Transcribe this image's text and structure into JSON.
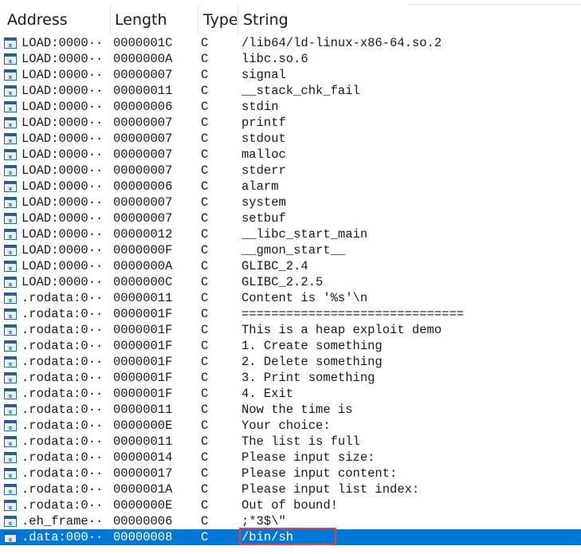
{
  "columns": {
    "address": "Address",
    "length": "Length",
    "type": "Type",
    "string": "String"
  },
  "rows": [
    {
      "address": "LOAD:0000···",
      "length": "0000001C",
      "type": "C",
      "string": "/lib64/ld-linux-x86-64.so.2"
    },
    {
      "address": "LOAD:0000···",
      "length": "0000000A",
      "type": "C",
      "string": "libc.so.6"
    },
    {
      "address": "LOAD:0000···",
      "length": "00000007",
      "type": "C",
      "string": "signal"
    },
    {
      "address": "LOAD:0000···",
      "length": "00000011",
      "type": "C",
      "string": "__stack_chk_fail"
    },
    {
      "address": "LOAD:0000···",
      "length": "00000006",
      "type": "C",
      "string": "stdin"
    },
    {
      "address": "LOAD:0000···",
      "length": "00000007",
      "type": "C",
      "string": "printf"
    },
    {
      "address": "LOAD:0000···",
      "length": "00000007",
      "type": "C",
      "string": "stdout"
    },
    {
      "address": "LOAD:0000···",
      "length": "00000007",
      "type": "C",
      "string": "malloc"
    },
    {
      "address": "LOAD:0000···",
      "length": "00000007",
      "type": "C",
      "string": "stderr"
    },
    {
      "address": "LOAD:0000···",
      "length": "00000006",
      "type": "C",
      "string": "alarm"
    },
    {
      "address": "LOAD:0000···",
      "length": "00000007",
      "type": "C",
      "string": "system"
    },
    {
      "address": "LOAD:0000···",
      "length": "00000007",
      "type": "C",
      "string": "setbuf"
    },
    {
      "address": "LOAD:0000···",
      "length": "00000012",
      "type": "C",
      "string": "__libc_start_main"
    },
    {
      "address": "LOAD:0000···",
      "length": "0000000F",
      "type": "C",
      "string": "__gmon_start__"
    },
    {
      "address": "LOAD:0000···",
      "length": "0000000A",
      "type": "C",
      "string": "GLIBC_2.4"
    },
    {
      "address": "LOAD:0000···",
      "length": "0000000C",
      "type": "C",
      "string": "GLIBC_2.2.5"
    },
    {
      "address": ".rodata:0···",
      "length": "00000011",
      "type": "C",
      "string": "Content is '%s'\\n"
    },
    {
      "address": ".rodata:0···",
      "length": "0000001F",
      "type": "C",
      "string": "=============================="
    },
    {
      "address": ".rodata:0···",
      "length": "0000001F",
      "type": "C",
      "string": " This is a heap exploit demo"
    },
    {
      "address": ".rodata:0···",
      "length": "0000001F",
      "type": "C",
      "string": "1. Create something"
    },
    {
      "address": ".rodata:0···",
      "length": "0000001F",
      "type": "C",
      "string": "2. Delete something"
    },
    {
      "address": ".rodata:0···",
      "length": "0000001F",
      "type": "C",
      "string": "3. Print something"
    },
    {
      "address": ".rodata:0···",
      "length": "0000001F",
      "type": "C",
      "string": "4. Exit"
    },
    {
      "address": ".rodata:0···",
      "length": "00000011",
      "type": "C",
      "string": "Now the time is"
    },
    {
      "address": ".rodata:0···",
      "length": "0000000E",
      "type": "C",
      "string": "Your choice:"
    },
    {
      "address": ".rodata:0···",
      "length": "00000011",
      "type": "C",
      "string": "The list is full"
    },
    {
      "address": ".rodata:0···",
      "length": "00000014",
      "type": "C",
      "string": "Please input size:"
    },
    {
      "address": ".rodata:0···",
      "length": "00000017",
      "type": "C",
      "string": "Please input content:"
    },
    {
      "address": ".rodata:0···",
      "length": "0000001A",
      "type": "C",
      "string": "Please input list index:"
    },
    {
      "address": ".rodata:0···",
      "length": "0000000E",
      "type": "C",
      "string": "Out of bound!"
    },
    {
      "address": ".eh_frame···",
      "length": "00000006",
      "type": "C",
      "string": ";*3$\\\""
    },
    {
      "address": ".data:000···",
      "length": "00000008",
      "type": "C",
      "string": "/bin/sh",
      "selected": true,
      "highlighted": true
    }
  ],
  "icons": {
    "row_icon": "string-entry-icon"
  },
  "colors": {
    "selection": "#0078d7",
    "highlight_box": "#e0414a",
    "icon_blue": "#1f5fa8"
  }
}
